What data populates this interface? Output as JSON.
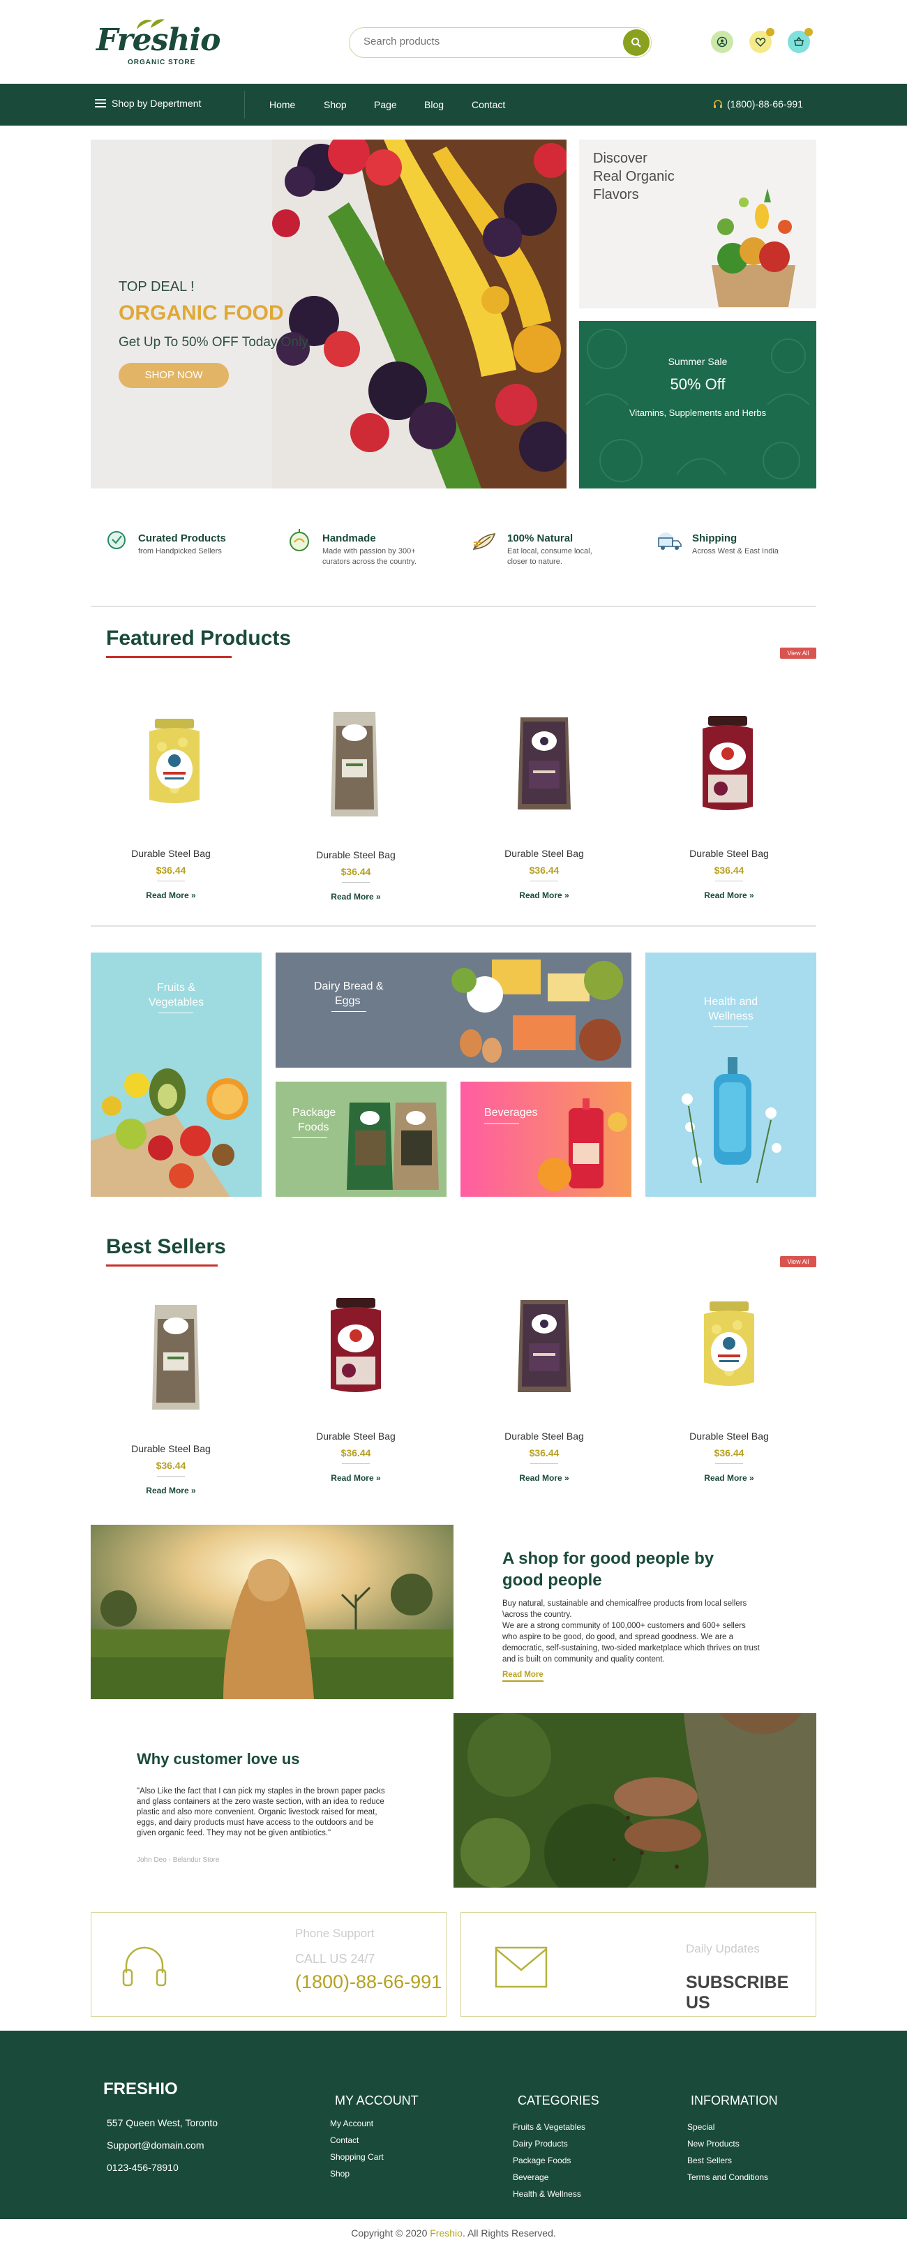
{
  "header": {
    "logo": "Freshio",
    "logo_sub": "ORGANIC STORE",
    "search_placeholder": "Search products"
  },
  "nav": {
    "department": "Shop by Depertment",
    "links": [
      "Home",
      "Shop",
      "Page",
      "Blog",
      "Contact"
    ],
    "phone": "(1800)-88-66-991"
  },
  "hero": {
    "deal": "TOP DEAL !",
    "title": "ORGANIC FOOD",
    "subtitle": "Get Up To 50% OFF Today Only",
    "button": "SHOP NOW"
  },
  "side_banner_1": {
    "text": "Discover\nReal Organic\nFlavors",
    "line1": "Discover",
    "line2": "Real Organic",
    "line3": "Flavors"
  },
  "side_banner_2": {
    "label": "Summer Sale",
    "offer": "50% Off",
    "desc": "Vitamins, Supplements and Herbs"
  },
  "features": [
    {
      "title": "Curated Products",
      "desc1": "from Handpicked Sellers",
      "desc2": ""
    },
    {
      "title": "Handmade",
      "desc1": "Made with passion by 300+",
      "desc2": "curators across the country."
    },
    {
      "title": "100% Natural",
      "desc1": "Eat local, consume local,",
      "desc2": "closer to nature."
    },
    {
      "title": "Shipping",
      "desc1": "Across West & East India",
      "desc2": ""
    }
  ],
  "featured": {
    "title": "Featured Products",
    "view_all": "View All",
    "products": [
      {
        "name": "Durable Steel Bag",
        "price": "$36.44",
        "read_more": "Read More"
      },
      {
        "name": "Durable Steel Bag",
        "price": "$36.44",
        "read_more": "Read More"
      },
      {
        "name": "Durable Steel Bag",
        "price": "$36.44",
        "read_more": "Read More"
      },
      {
        "name": "Durable Steel Bag",
        "price": "$36.44",
        "read_more": "Read More"
      }
    ]
  },
  "categories": {
    "fruits": {
      "l1": "Fruits &",
      "l2": "Vegetables"
    },
    "dairy": {
      "l1": "Dairy Bread &",
      "l2": "Eggs"
    },
    "package": {
      "l1": "Package",
      "l2": "Foods"
    },
    "beverages": {
      "l1": "Beverages",
      "l2": ""
    },
    "health": {
      "l1": "Health and",
      "l2": "Wellness"
    }
  },
  "best_sellers": {
    "title": "Best Sellers",
    "view_all": "View All",
    "products": [
      {
        "name": "Durable Steel Bag",
        "price": "$36.44",
        "read_more": "Read More"
      },
      {
        "name": "Durable Steel Bag",
        "price": "$36.44",
        "read_more": "Read More"
      },
      {
        "name": "Durable Steel Bag",
        "price": "$36.44",
        "read_more": "Read More"
      },
      {
        "name": "Durable Steel Bag",
        "price": "$36.44",
        "read_more": "Read More"
      }
    ]
  },
  "about": {
    "title": "A shop for good people by good people",
    "p1": "Buy natural, sustainable and chemicalfree products from local sellers \\across the country.",
    "p2": "We are a strong community of 100,000+ customers and 600+ sellers who aspire to be good, do good, and spread goodness. We are a democratic, self-sustaining, two-sided marketplace which thrives on trust and is built on community and quality content.",
    "read_more": "Read More"
  },
  "testimonial": {
    "title": "Why customer love us",
    "quote": "\"Also Like the fact that I can pick my staples in the brown paper packs and glass containers at the zero waste section, with an idea to reduce plastic and also more convenient. Organic livestock raised for meat, eggs, and dairy products must have access to the outdoors and be given organic feed. They may not be given antibiotics.\"",
    "author": "John Deo - Belandur Store"
  },
  "support": {
    "label": "Phone Support",
    "call": "CALL US 24/7",
    "phone": "(1800)-88-66-991"
  },
  "subscribe": {
    "label": "Daily Updates",
    "cta": "SUBSCRIBE US"
  },
  "footer": {
    "brand": "FRESHIO",
    "address": "557 Queen West, Toronto",
    "email": "Support@domain.com",
    "phone": "0123-456-78910",
    "account": {
      "title": "MY ACCOUNT",
      "links": [
        "My Account",
        "Contact",
        "Shopping Cart",
        "Shop"
      ]
    },
    "categories": {
      "title": "CATEGORIES",
      "links": [
        "Fruits & Vegetables",
        "Dairy Products",
        "Package Foods",
        "Beverage",
        "Health & Wellness"
      ]
    },
    "information": {
      "title": "INFORMATION",
      "links": [
        "Special",
        "New Products",
        "Best Sellers",
        "Terms and Conditions"
      ]
    },
    "copyright_prefix": "Copyright © 2020 ",
    "copyright_brand": "Freshio",
    "copyright_suffix": ". All Rights Reserved."
  },
  "colors": {
    "primary": "#1a4a3a",
    "accent": "#b8a122",
    "hero_orange": "#e0a836",
    "red": "#c8302a"
  }
}
